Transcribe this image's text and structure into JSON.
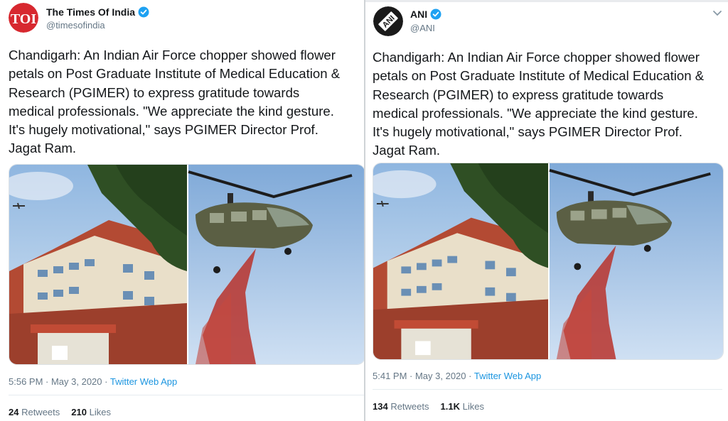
{
  "colors": {
    "link": "#1b95e0",
    "verified": "#1da1f2",
    "toi_brand": "#d7282f",
    "ani_brand": "#1a1a1a",
    "secondary_text": "#657786"
  },
  "tweets": [
    {
      "account": {
        "name": "The Times Of India",
        "handle": "@timesofindia",
        "avatar_text": "TOI",
        "verified": true
      },
      "text": "Chandigarh: An Indian Air Force chopper showed flower\npetals on Post Graduate Institute of Medical Education &\nResearch (PGIMER) to express gratitude towards\nmedical professionals. \"We appreciate the kind gesture.\nIt's hugely motivational,\" says PGIMER Director Prof.\nJagat Ram.",
      "time": "5:56 PM · May 3, 2020 · ",
      "source": "Twitter Web App",
      "retweets": "24",
      "retweets_label": " Retweets",
      "likes": "210",
      "likes_label": " Likes"
    },
    {
      "account": {
        "name": "ANI",
        "handle": "@ANI",
        "avatar_text": "ANI",
        "verified": true
      },
      "text": "Chandigarh: An Indian Air Force chopper showed flower\npetals on Post Graduate Institute of Medical Education &\nResearch (PGIMER) to express gratitude towards\nmedical professionals. \"We appreciate the kind gesture.\nIt's hugely motivational,\" says PGIMER Director Prof.\nJagat Ram.",
      "time": "5:41 PM · May 3, 2020 · ",
      "source": "Twitter Web App",
      "retweets": "134",
      "retweets_label": " Retweets",
      "likes": "1.1K",
      "likes_label": " Likes"
    }
  ],
  "icons": {
    "verified": "verified-badge-icon",
    "more": "chevron-down-icon"
  }
}
